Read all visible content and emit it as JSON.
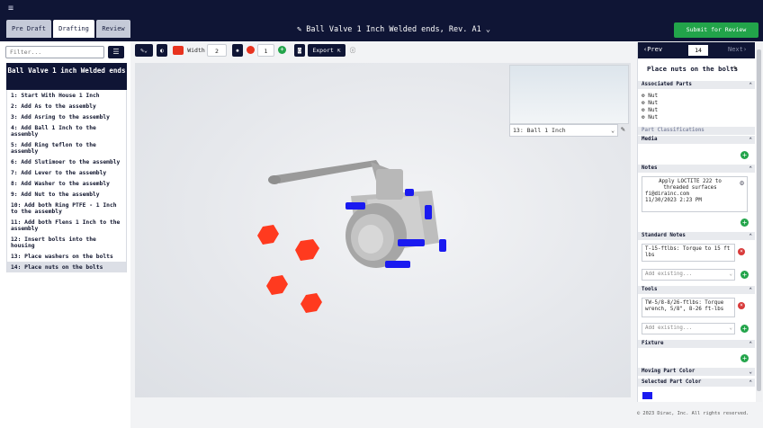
{
  "topbar": {
    "menu_icon": "hamburger-icon",
    "tabs": [
      "Pre Draft",
      "Drafting",
      "Review"
    ],
    "title": "Ball Valve 1 Inch Welded ends, Rev. A1",
    "submit": "Submit for Review"
  },
  "sidebar": {
    "filter_placeholder": "Filter...",
    "group_title": "Ball Valve 1 inch Welded ends",
    "steps": [
      "1: Start With House 1 Inch",
      "2: Add As to the assembly",
      "3: Add Asring to the assembly",
      "4: Add Ball 1 Inch to the assembly",
      "5: Add Ring teflon to the assembly",
      "6: Add Slutimoer to the assembly",
      "7: Add Lever to the assembly",
      "8: Add Washer to the assembly",
      "9: Add Nut to the assembly",
      "10: Add both Ring PTFE - 1 Inch to the assembly",
      "11: Add both Flens 1 Inch to the assembly",
      "12: Insert bolts into the housing",
      "13: Place washers on the bolts",
      "14: Place nuts on the bolts"
    ]
  },
  "toolbar": {
    "width_label": "Width",
    "width_value": "2",
    "count_value": "1",
    "export_label": "Export",
    "draw_color": "#e8331f"
  },
  "viewport": {
    "minimap_select": "13: Ball 1 Inch"
  },
  "right_panel": {
    "prev": "Prev",
    "step_number": "14",
    "next": "Next",
    "step_name": "Place nuts on the bolts",
    "associated_parts_title": "Associated Parts",
    "associated_parts": [
      "Nut",
      "Nut",
      "Nut",
      "Nut"
    ],
    "part_classifications_title": "Part Classifications",
    "media_title": "Media",
    "notes_title": "Notes",
    "note_text": "Apply LOCTITE 222 to threaded surfaces",
    "note_author": "fi@dirainc.com",
    "note_date": "11/30/2023 2:23 PM",
    "standard_notes_title": "Standard Notes",
    "standard_note": "T-15-ftlbs: Torque to 15 ft lbs",
    "add_existing": "Add existing...",
    "tools_title": "Tools",
    "tool": "TW-5/8-8/26-ftlbs: Torque wrench, 5/8\", 8-26 ft-lbs",
    "fixture_title": "Fixture",
    "moving_part_color_title": "Moving Part Color",
    "selected_part_color_title": "Selected Part Color",
    "selected_color": "#1a1af0"
  },
  "footer": "© 2023 Dirac, Inc. All rights reserved."
}
